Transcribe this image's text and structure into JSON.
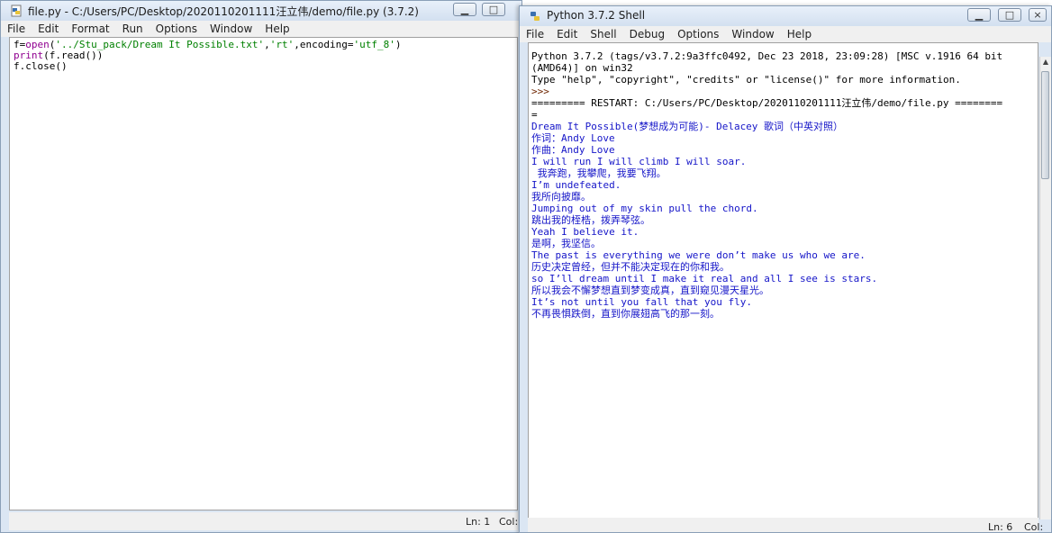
{
  "editor": {
    "title": "file.py - C:/Users/PC/Desktop/2020110201111汪立伟/demo/file.py (3.7.2)",
    "menu": [
      "File",
      "Edit",
      "Format",
      "Run",
      "Options",
      "Window",
      "Help"
    ],
    "code": {
      "line1": {
        "a": "f=",
        "b": "open",
        "c": "(",
        "d": "'../Stu_pack/Dream It Possible.txt'",
        "e": ",",
        "f": "'rt'",
        "g": ",encoding=",
        "h": "'utf_8'",
        "i": ")"
      },
      "line2": {
        "a": "print",
        "b": "(f.read())"
      },
      "line3": "f.close()"
    },
    "status": {
      "ln": "Ln: 1",
      "col": "Col:"
    }
  },
  "shell": {
    "title": "Python 3.7.2 Shell",
    "menu": [
      "File",
      "Edit",
      "Shell",
      "Debug",
      "Options",
      "Window",
      "Help"
    ],
    "header": [
      "Python 3.7.2 (tags/v3.7.2:9a3ffc0492, Dec 23 2018, 23:09:28) [MSC v.1916 64 bit",
      "(AMD64)] on win32",
      "Type \"help\", \"copyright\", \"credits\" or \"license()\" for more information."
    ],
    "prompt": ">>>",
    "restart": [
      "========= RESTART: C:/Users/PC/Desktop/2020110201111汪立伟/demo/file.py ========",
      "="
    ],
    "output": [
      "Dream It Possible(梦想成为可能)- Delacey 歌词（中英对照）",
      "",
      "作词：Andy Love",
      "",
      "作曲：Andy Love",
      "",
      "I will run I will climb I will soar.",
      "",
      " 我奔跑，我攀爬，我要飞翔。",
      "",
      "I’m undefeated.",
      "",
      "我所向披靡。",
      "",
      "Jumping out of my skin pull the chord.",
      "",
      "跳出我的桎梏，拨弄琴弦。",
      "",
      "Yeah I believe it.",
      "",
      "是啊，我坚信。",
      "",
      "The past is everything we were don’t make us who we are.",
      "",
      "历史决定曾经，但并不能决定现在的你和我。",
      "",
      "so I’ll dream until I make it real and all I see is stars.",
      "",
      "所以我会不懈梦想直到梦变成真，直到窥见漫天星光。",
      "",
      "It’s not until you fall that you fly.",
      "",
      "不再畏惧跌倒，直到你展翅高飞的那一刻。"
    ],
    "status": {
      "ln": "Ln: 6",
      "col": "Col: 0"
    }
  }
}
